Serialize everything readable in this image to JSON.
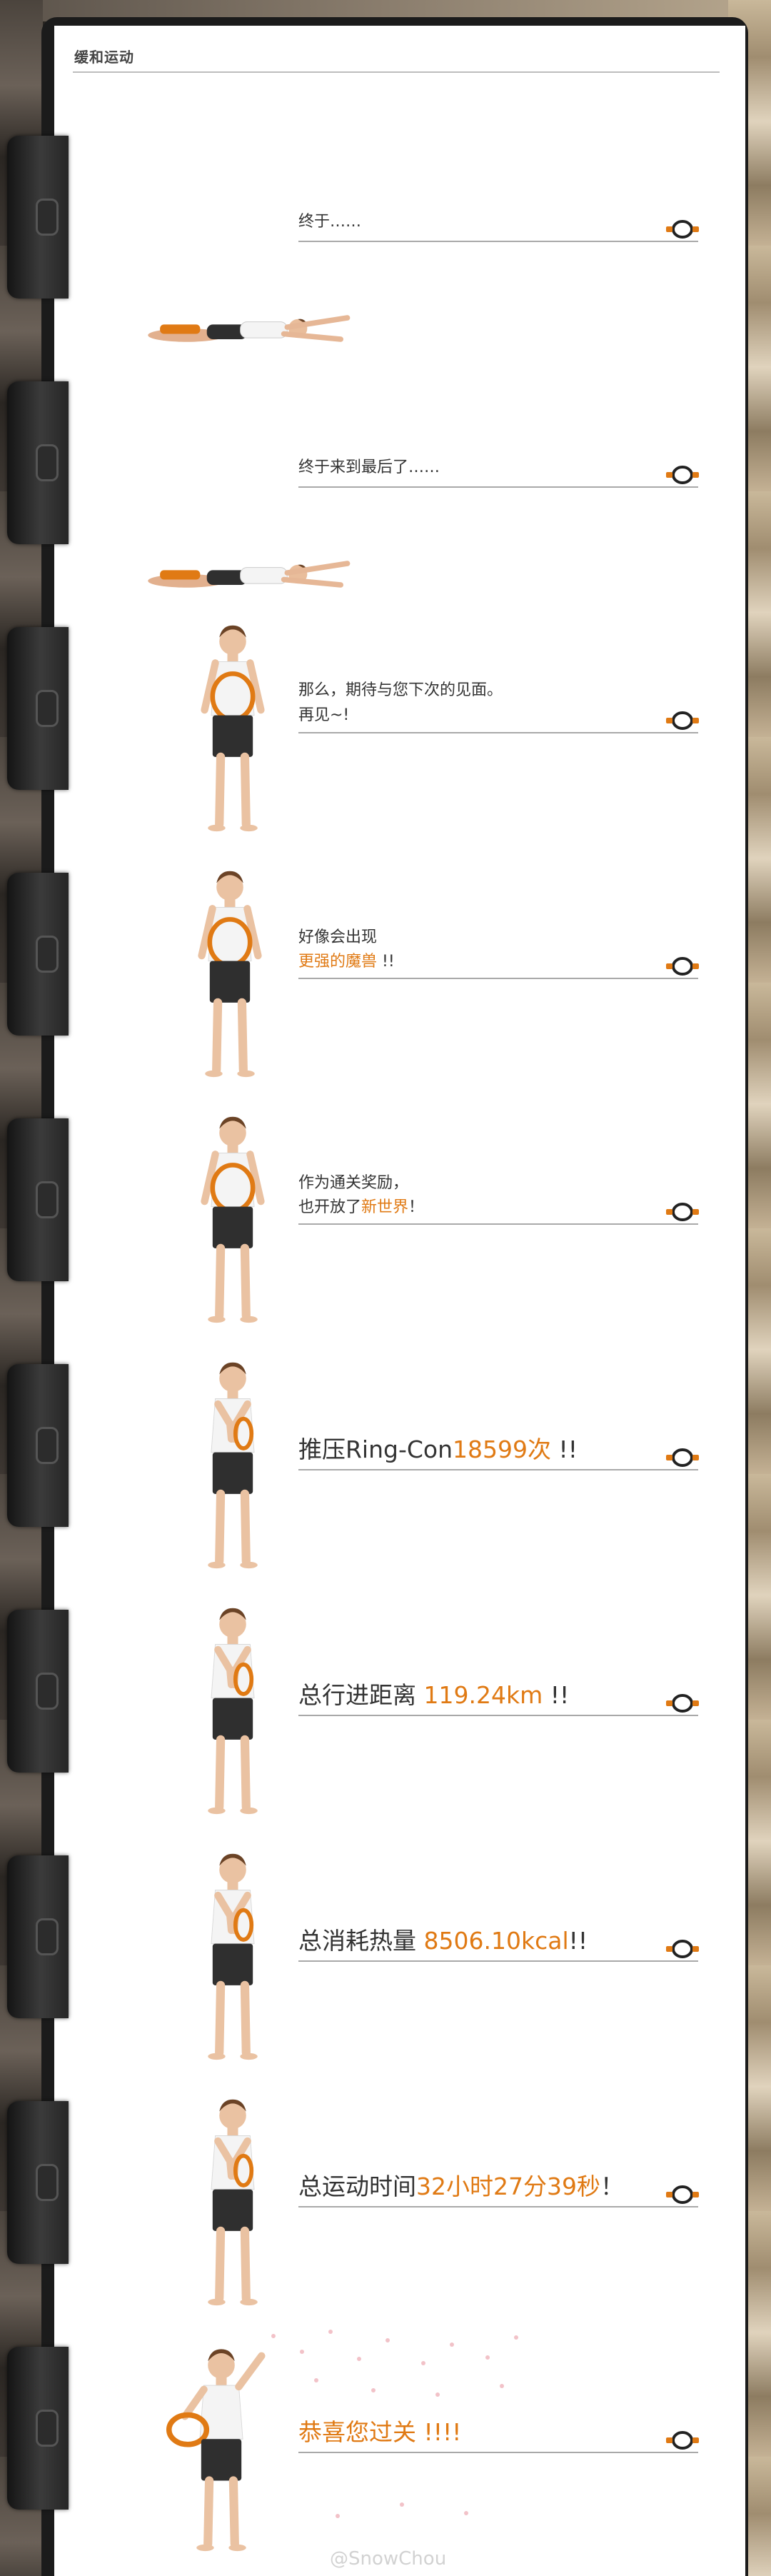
{
  "header": {
    "title": "缓和运动"
  },
  "panels": [
    {
      "kind": "lying",
      "line1": "终于……",
      "line2": ""
    },
    {
      "kind": "lying",
      "line1": "终于来到最后了……",
      "line2": ""
    },
    {
      "kind": "standing",
      "line1": "那么，期待与您下次的见面。",
      "line2": "再见~!"
    },
    {
      "kind": "standing",
      "line1": "好像会出现",
      "line2_hl": "更强的魔兽",
      "line2_tail": " !!"
    },
    {
      "kind": "standing",
      "line1": "作为通关奖励，",
      "line2_pre": "也开放了",
      "line2_hl": "新世界",
      "line2_tail": "！"
    },
    {
      "kind": "big",
      "pre": "推压Ring-Con",
      "hl": "18599次",
      "tail": " !!"
    },
    {
      "kind": "big",
      "pre": "总行进距离 ",
      "hl": "119.24km",
      "tail": "  !!"
    },
    {
      "kind": "big",
      "pre": "总消耗热量 ",
      "hl": "8506.10kcal",
      "tail": "!!"
    },
    {
      "kind": "big",
      "pre": "总运动时间",
      "hl": "32小时27分39秒",
      "tail": "！"
    },
    {
      "kind": "final",
      "hl": "恭喜您过关 !!!!"
    }
  ],
  "watermark": "@SnowChou",
  "colors": {
    "accent": "#e07a14",
    "ring": "#e07a14",
    "text": "#333333",
    "line": "#a9a9a9"
  },
  "icons": {
    "ring": "ring-con-icon",
    "controller": "joy-con-icon"
  }
}
